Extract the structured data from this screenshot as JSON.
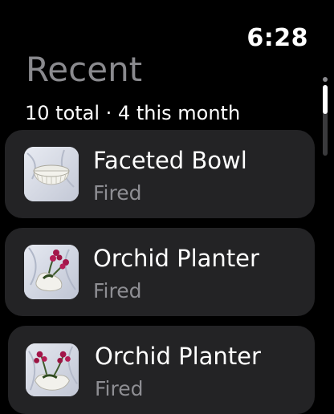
{
  "status_bar": {
    "time": "6:28"
  },
  "header": {
    "title": "Recent"
  },
  "summary": {
    "text": "10 total · 4 this month"
  },
  "list": {
    "items": [
      {
        "title": "Faceted Bowl",
        "subtitle": "Fired",
        "thumbnail": "bowl-photo"
      },
      {
        "title": "Orchid Planter",
        "subtitle": "Fired",
        "thumbnail": "orchid-planter-photo"
      },
      {
        "title": "Orchid Planter",
        "subtitle": "Fired",
        "thumbnail": "orchid-planter-photo"
      }
    ]
  },
  "colors": {
    "background": "#000000",
    "cell_background": "#232325",
    "title_gray": "#8a8a8e",
    "subtitle_gray": "#8e8e93",
    "scroll_thumb": "#ffffff"
  }
}
